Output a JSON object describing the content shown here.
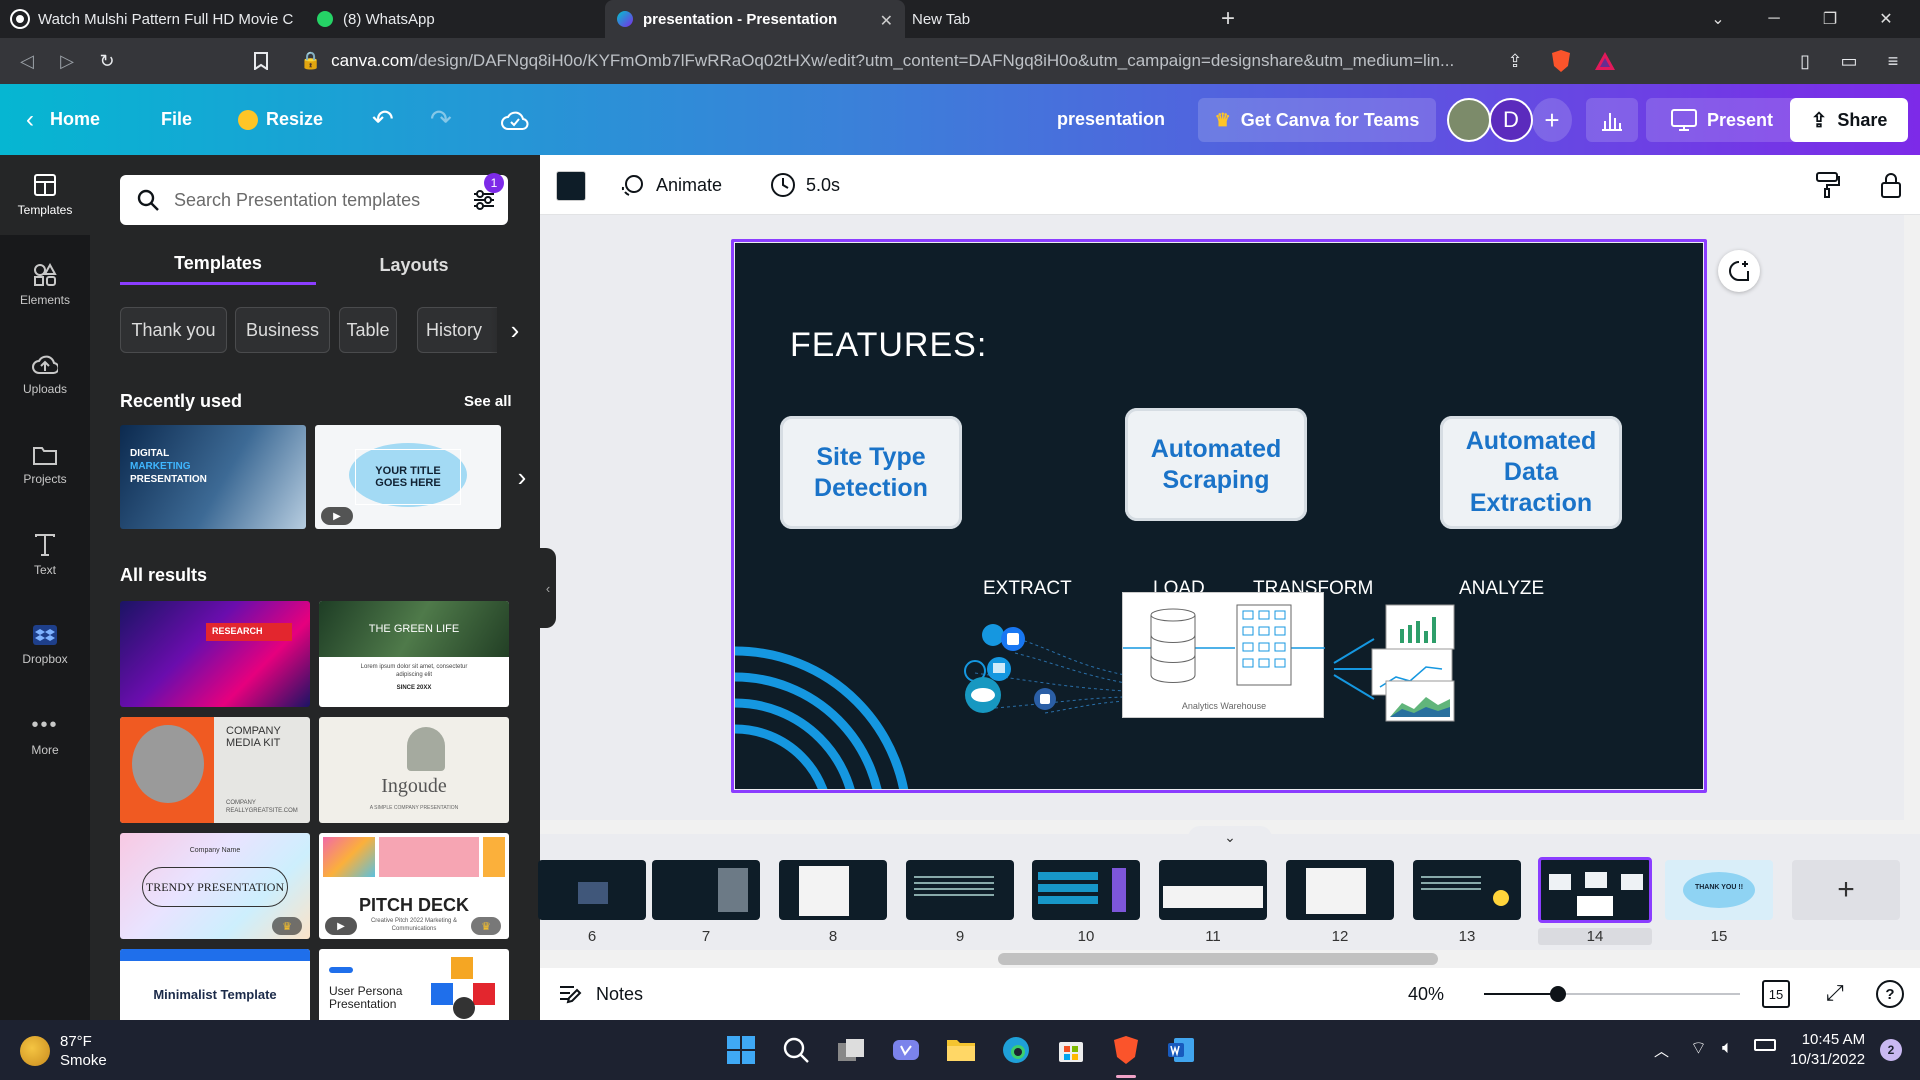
{
  "browser": {
    "tabs": [
      {
        "title": "Watch Mulshi Pattern Full HD Movie C",
        "active": false
      },
      {
        "title": "(8) WhatsApp",
        "active": false
      },
      {
        "title": "presentation - Presentation",
        "active": true
      },
      {
        "title": "New Tab",
        "active": false
      }
    ],
    "url_host": "canva.com",
    "url_path": "/design/DAFNgq8iH0o/KYFmOmb7lFwRRaOq02tHXw/edit?utm_content=DAFNgq8iH0o&utm_campaign=designshare&utm_medium=lin..."
  },
  "header": {
    "home": "Home",
    "file": "File",
    "resize": "Resize",
    "doc_title": "presentation",
    "teams": "Get Canva for Teams",
    "avatar_letter": "D",
    "present": "Present",
    "share": "Share"
  },
  "rail": [
    {
      "label": "Templates",
      "icon": "templates-icon"
    },
    {
      "label": "Elements",
      "icon": "elements-icon"
    },
    {
      "label": "Uploads",
      "icon": "uploads-icon"
    },
    {
      "label": "Projects",
      "icon": "projects-icon"
    },
    {
      "label": "Text",
      "icon": "text-icon"
    },
    {
      "label": "Dropbox",
      "icon": "dropbox-icon"
    },
    {
      "label": "More",
      "icon": "more-icon"
    }
  ],
  "panel": {
    "search_placeholder": "Search Presentation templates",
    "filter_badge": "1",
    "tabs": [
      "Templates",
      "Layouts"
    ],
    "chips": [
      "Thank you",
      "Business",
      "Table",
      "History"
    ],
    "recently_used": "Recently used",
    "see_all": "See all",
    "recent": [
      {
        "lines": [
          "DIGITAL",
          "MARKETING",
          "PRESENTATION"
        ]
      },
      {
        "lines": [
          "YOUR TITLE",
          "GOES HERE"
        ]
      }
    ],
    "all_results": "All results",
    "results": [
      {
        "title": "RESEARCH"
      },
      {
        "title": "THE GREEN LIFE",
        "sub": "Lorem ipsum dolor sit amet, consectetur adipiscing elit",
        "foot": "SINCE 20XX"
      },
      {
        "title": "COMPANY MEDIA KIT",
        "foot": "COMPANY REALLYGREATSITE.COM"
      },
      {
        "title": "Ingoude",
        "sub": "A SIMPLE COMPANY PRESENTATION"
      },
      {
        "title": "TRENDY PRESENTATION",
        "sub": "Company Name"
      },
      {
        "title": "PITCH DECK",
        "sub": "Creative Pitch 2022 Marketing & Communications"
      },
      {
        "title": "Minimalist Template"
      },
      {
        "title": "User Persona Presentation"
      }
    ]
  },
  "toolbar": {
    "animate": "Animate",
    "duration": "5.0s"
  },
  "slide": {
    "heading": "FEATURES:",
    "features": [
      "Site Type Detection",
      "Automated Scraping",
      "Automated Data Extraction"
    ],
    "stages": [
      "EXTRACT",
      "LOAD",
      "TRANSFORM",
      "ANALYZE"
    ],
    "warehouse_label": "Analytics Warehouse"
  },
  "filmstrip": {
    "pages": [
      "6",
      "7",
      "8",
      "9",
      "10",
      "11",
      "12",
      "13",
      "14",
      "15"
    ],
    "selected": "14",
    "thank_you": "THANK YOU !!"
  },
  "bottombar": {
    "notes": "Notes",
    "zoom": "40%",
    "zoom_fraction": 0.4,
    "page_count": "15"
  },
  "taskbar": {
    "temp": "87°F",
    "weather": "Smoke",
    "time": "10:45 AM",
    "date": "10/31/2022",
    "notif": "2"
  }
}
